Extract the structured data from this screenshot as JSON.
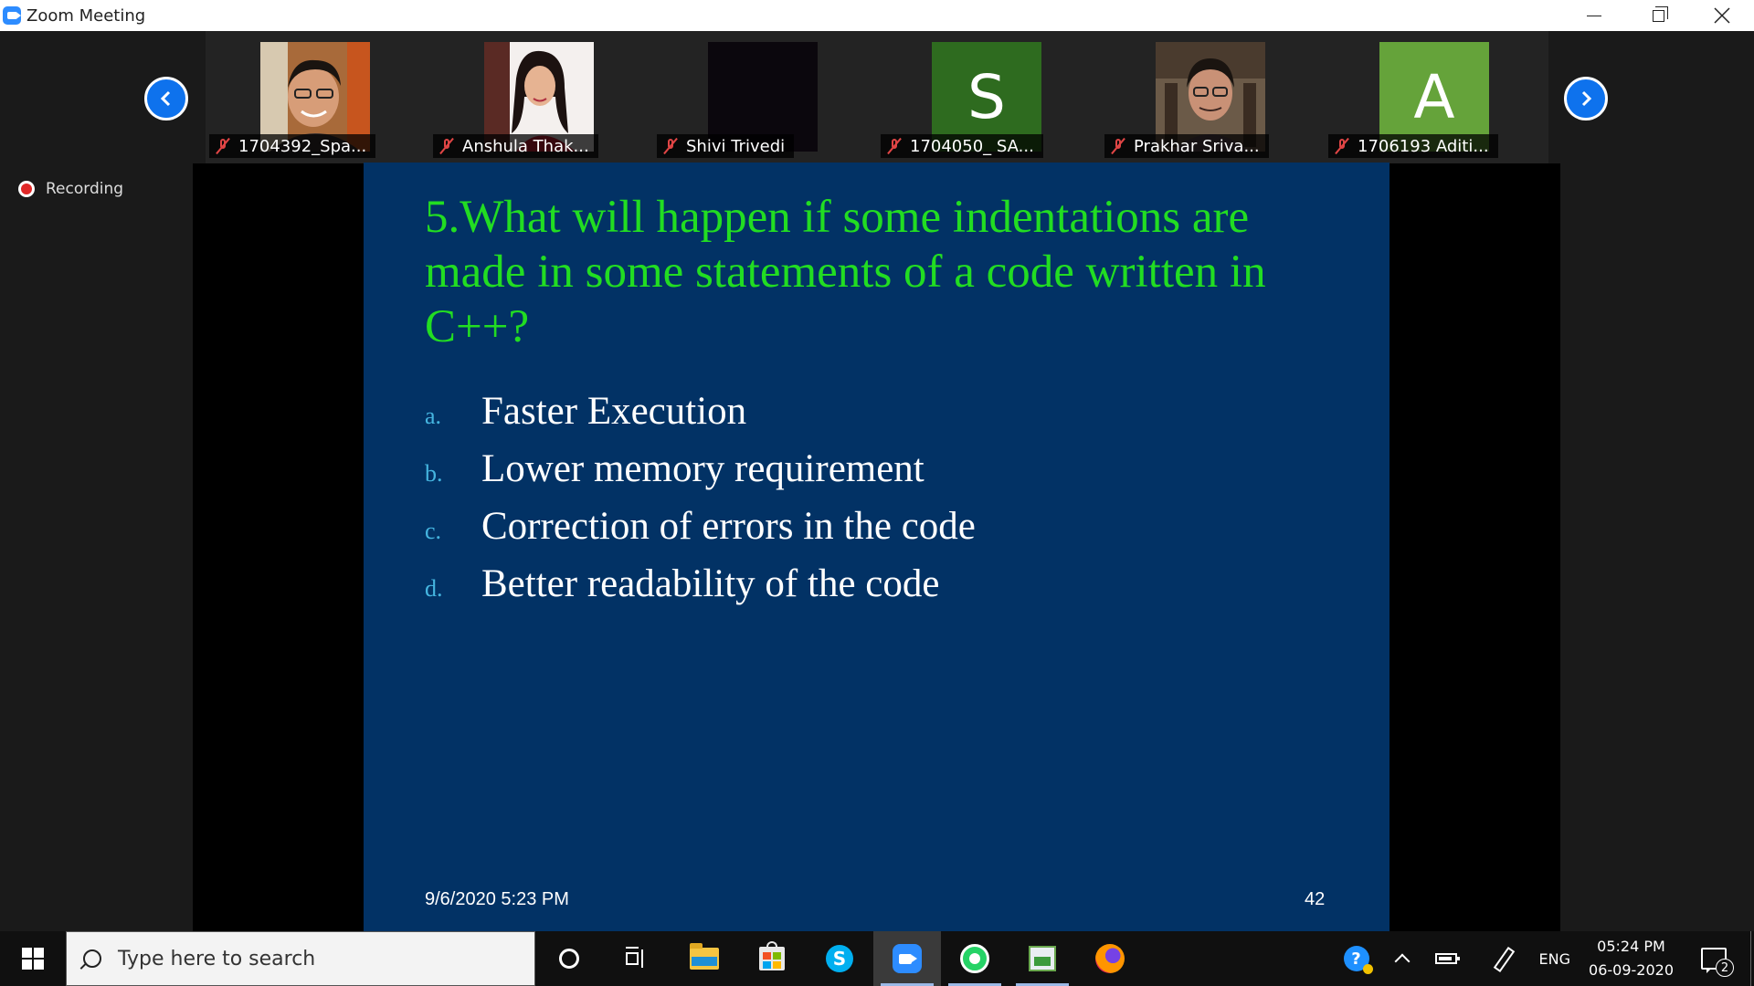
{
  "window": {
    "title": "Zoom Meeting"
  },
  "gallery": {
    "participants": [
      {
        "name": "1704392_Spa...",
        "avatar": "photo",
        "muted": true
      },
      {
        "name": "Anshula Thak...",
        "avatar": "photo",
        "muted": true
      },
      {
        "name": "Shivi Trivedi",
        "avatar": "video-off",
        "muted": true
      },
      {
        "name": "1704050_ SA...",
        "avatar": "letter",
        "letter": "S",
        "avatar_color": "#2e6b1f",
        "muted": true
      },
      {
        "name": "Prakhar Sriva...",
        "avatar": "photo",
        "muted": true
      },
      {
        "name": "1706193 Aditi...",
        "avatar": "letter",
        "letter": "A",
        "avatar_color": "#65a33a",
        "muted": true
      }
    ],
    "prev_icon": "chevron-left-icon",
    "next_icon": "chevron-right-icon"
  },
  "recording": {
    "label": "Recording"
  },
  "slide": {
    "question": "5.What will happen if some indentations are made in some statements of a code written in C++?",
    "options": [
      {
        "letter": "a.",
        "text": "Faster Execution"
      },
      {
        "letter": "b.",
        "text": "Lower memory requirement"
      },
      {
        "letter": "c.",
        "text": "Correction of errors in the code"
      },
      {
        "letter": "d.",
        "text": "Better readability of the code"
      }
    ],
    "datestamp": "9/6/2020 5:23 PM",
    "page_number": "42",
    "colors": {
      "background": "#023265",
      "question": "#22dd22",
      "option_text": "#ffffff",
      "option_letter": "#45b5e0"
    }
  },
  "taskbar": {
    "search_placeholder": "Type here to search",
    "skype_letter": "S",
    "apps": [
      "cortana-icon",
      "task-view-icon",
      "file-explorer-icon",
      "microsoft-store-icon",
      "skype-icon",
      "zoom-icon",
      "whatsapp-icon",
      "paint-icon",
      "firefox-icon"
    ],
    "tray": {
      "help_glyph": "?",
      "language": "ENG",
      "time": "05:24 PM",
      "date": "06-09-2020",
      "notification_count": "2"
    }
  }
}
